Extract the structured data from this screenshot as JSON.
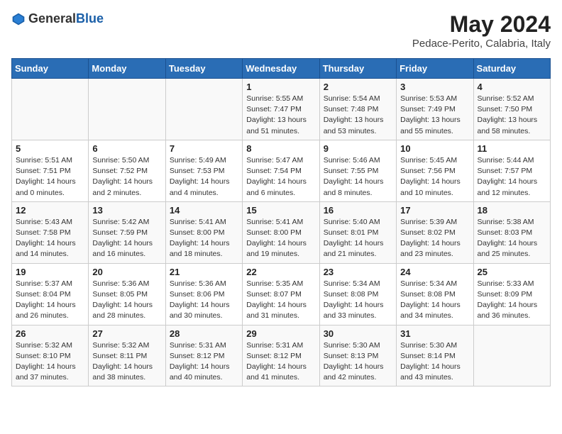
{
  "logo": {
    "general": "General",
    "blue": "Blue"
  },
  "title": "May 2024",
  "location": "Pedace-Perito, Calabria, Italy",
  "days_header": [
    "Sunday",
    "Monday",
    "Tuesday",
    "Wednesday",
    "Thursday",
    "Friday",
    "Saturday"
  ],
  "weeks": [
    [
      {
        "day": "",
        "info": ""
      },
      {
        "day": "",
        "info": ""
      },
      {
        "day": "",
        "info": ""
      },
      {
        "day": "1",
        "info": "Sunrise: 5:55 AM\nSunset: 7:47 PM\nDaylight: 13 hours\nand 51 minutes."
      },
      {
        "day": "2",
        "info": "Sunrise: 5:54 AM\nSunset: 7:48 PM\nDaylight: 13 hours\nand 53 minutes."
      },
      {
        "day": "3",
        "info": "Sunrise: 5:53 AM\nSunset: 7:49 PM\nDaylight: 13 hours\nand 55 minutes."
      },
      {
        "day": "4",
        "info": "Sunrise: 5:52 AM\nSunset: 7:50 PM\nDaylight: 13 hours\nand 58 minutes."
      }
    ],
    [
      {
        "day": "5",
        "info": "Sunrise: 5:51 AM\nSunset: 7:51 PM\nDaylight: 14 hours\nand 0 minutes."
      },
      {
        "day": "6",
        "info": "Sunrise: 5:50 AM\nSunset: 7:52 PM\nDaylight: 14 hours\nand 2 minutes."
      },
      {
        "day": "7",
        "info": "Sunrise: 5:49 AM\nSunset: 7:53 PM\nDaylight: 14 hours\nand 4 minutes."
      },
      {
        "day": "8",
        "info": "Sunrise: 5:47 AM\nSunset: 7:54 PM\nDaylight: 14 hours\nand 6 minutes."
      },
      {
        "day": "9",
        "info": "Sunrise: 5:46 AM\nSunset: 7:55 PM\nDaylight: 14 hours\nand 8 minutes."
      },
      {
        "day": "10",
        "info": "Sunrise: 5:45 AM\nSunset: 7:56 PM\nDaylight: 14 hours\nand 10 minutes."
      },
      {
        "day": "11",
        "info": "Sunrise: 5:44 AM\nSunset: 7:57 PM\nDaylight: 14 hours\nand 12 minutes."
      }
    ],
    [
      {
        "day": "12",
        "info": "Sunrise: 5:43 AM\nSunset: 7:58 PM\nDaylight: 14 hours\nand 14 minutes."
      },
      {
        "day": "13",
        "info": "Sunrise: 5:42 AM\nSunset: 7:59 PM\nDaylight: 14 hours\nand 16 minutes."
      },
      {
        "day": "14",
        "info": "Sunrise: 5:41 AM\nSunset: 8:00 PM\nDaylight: 14 hours\nand 18 minutes."
      },
      {
        "day": "15",
        "info": "Sunrise: 5:41 AM\nSunset: 8:00 PM\nDaylight: 14 hours\nand 19 minutes."
      },
      {
        "day": "16",
        "info": "Sunrise: 5:40 AM\nSunset: 8:01 PM\nDaylight: 14 hours\nand 21 minutes."
      },
      {
        "day": "17",
        "info": "Sunrise: 5:39 AM\nSunset: 8:02 PM\nDaylight: 14 hours\nand 23 minutes."
      },
      {
        "day": "18",
        "info": "Sunrise: 5:38 AM\nSunset: 8:03 PM\nDaylight: 14 hours\nand 25 minutes."
      }
    ],
    [
      {
        "day": "19",
        "info": "Sunrise: 5:37 AM\nSunset: 8:04 PM\nDaylight: 14 hours\nand 26 minutes."
      },
      {
        "day": "20",
        "info": "Sunrise: 5:36 AM\nSunset: 8:05 PM\nDaylight: 14 hours\nand 28 minutes."
      },
      {
        "day": "21",
        "info": "Sunrise: 5:36 AM\nSunset: 8:06 PM\nDaylight: 14 hours\nand 30 minutes."
      },
      {
        "day": "22",
        "info": "Sunrise: 5:35 AM\nSunset: 8:07 PM\nDaylight: 14 hours\nand 31 minutes."
      },
      {
        "day": "23",
        "info": "Sunrise: 5:34 AM\nSunset: 8:08 PM\nDaylight: 14 hours\nand 33 minutes."
      },
      {
        "day": "24",
        "info": "Sunrise: 5:34 AM\nSunset: 8:08 PM\nDaylight: 14 hours\nand 34 minutes."
      },
      {
        "day": "25",
        "info": "Sunrise: 5:33 AM\nSunset: 8:09 PM\nDaylight: 14 hours\nand 36 minutes."
      }
    ],
    [
      {
        "day": "26",
        "info": "Sunrise: 5:32 AM\nSunset: 8:10 PM\nDaylight: 14 hours\nand 37 minutes."
      },
      {
        "day": "27",
        "info": "Sunrise: 5:32 AM\nSunset: 8:11 PM\nDaylight: 14 hours\nand 38 minutes."
      },
      {
        "day": "28",
        "info": "Sunrise: 5:31 AM\nSunset: 8:12 PM\nDaylight: 14 hours\nand 40 minutes."
      },
      {
        "day": "29",
        "info": "Sunrise: 5:31 AM\nSunset: 8:12 PM\nDaylight: 14 hours\nand 41 minutes."
      },
      {
        "day": "30",
        "info": "Sunrise: 5:30 AM\nSunset: 8:13 PM\nDaylight: 14 hours\nand 42 minutes."
      },
      {
        "day": "31",
        "info": "Sunrise: 5:30 AM\nSunset: 8:14 PM\nDaylight: 14 hours\nand 43 minutes."
      },
      {
        "day": "",
        "info": ""
      }
    ]
  ]
}
